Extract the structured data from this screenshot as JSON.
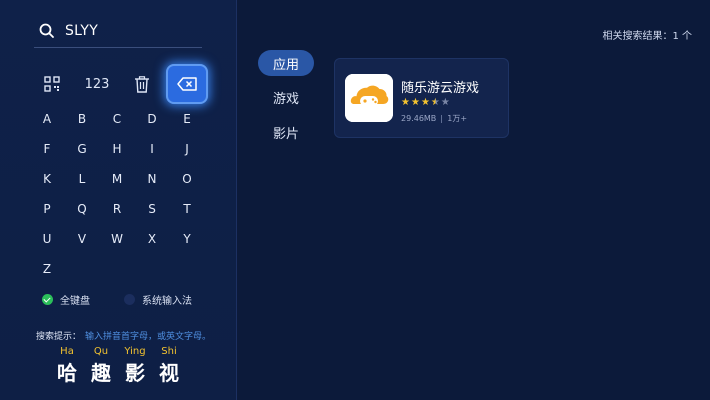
{
  "search": {
    "query": "SLYY"
  },
  "keyboard": {
    "num_label": "123",
    "letters": [
      "A",
      "B",
      "C",
      "D",
      "E",
      "F",
      "G",
      "H",
      "I",
      "J",
      "K",
      "L",
      "M",
      "N",
      "O",
      "P",
      "Q",
      "R",
      "S",
      "T",
      "U",
      "V",
      "W",
      "X",
      "Y",
      "Z"
    ]
  },
  "input_modes": [
    {
      "label": "全键盘",
      "selected": true
    },
    {
      "label": "系统输入法",
      "selected": false
    }
  ],
  "hint": {
    "label": "搜索提示：",
    "text": "输入拼音首字母，或英文字母。"
  },
  "brand": {
    "pinyin": [
      "Ha",
      "Qu",
      "Ying",
      "Shi"
    ],
    "chars": [
      "哈",
      "趣",
      "影",
      "视"
    ]
  },
  "tabs": [
    {
      "label": "应用",
      "active": true
    },
    {
      "label": "游戏",
      "active": false
    },
    {
      "label": "影片",
      "active": false
    }
  ],
  "results": {
    "count_text": "相关搜索结果：1 个",
    "items": [
      {
        "title": "随乐游云游戏",
        "rating": 3.5,
        "size": "29.46MB",
        "downloads": "1万+",
        "icon": "gamepad-cloud-icon"
      }
    ]
  },
  "colors": {
    "accent": "#2b6be0",
    "star": "#f2c230",
    "background": "#0c1a3a",
    "hint": "#4f8fe0",
    "selected": "#2bbf5a"
  }
}
